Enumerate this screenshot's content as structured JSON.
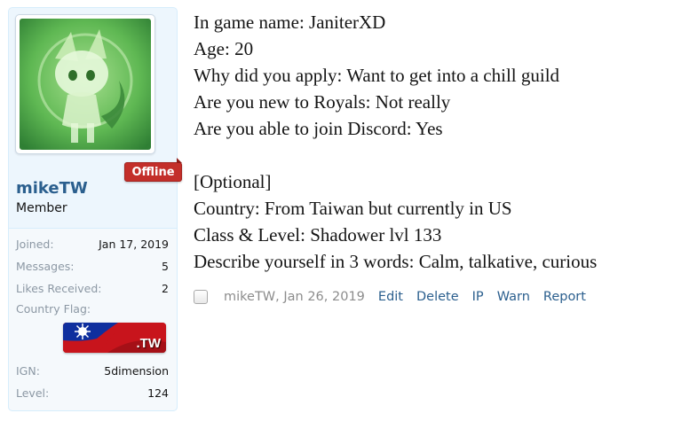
{
  "user": {
    "status_badge": "Offline",
    "username": "mikeTW",
    "title": "Member",
    "stats": [
      {
        "label": "Joined:",
        "value": "Jan 17, 2019"
      },
      {
        "label": "Messages:",
        "value": "5"
      },
      {
        "label": "Likes Received:",
        "value": "2"
      }
    ],
    "flag_label": "Country Flag:",
    "flag_code": ".TW",
    "extra_stats": [
      {
        "label": "IGN:",
        "value": "5dimension"
      },
      {
        "label": "Level:",
        "value": "124"
      }
    ]
  },
  "message": {
    "lines": [
      "In game name: JaniterXD",
      "Age: 20",
      "Why did you apply: Want to get into a chill guild",
      "Are you new to Royals: Not really",
      "Are you able to join Discord: Yes",
      "[Optional]",
      "Country: From Taiwan but currently in US",
      "Class & Level: Shadower lvl 133",
      "Describe yourself in 3 words: Calm, talkative, curious"
    ]
  },
  "meta": {
    "author": "mikeTW",
    "date": "Jan 26, 2019",
    "actions": [
      "Edit",
      "Delete",
      "IP",
      "Warn",
      "Report"
    ]
  },
  "colors": {
    "link": "#2b5f8e",
    "badge": "#c32f2a",
    "sidebar_bg": "#edf6fd"
  }
}
